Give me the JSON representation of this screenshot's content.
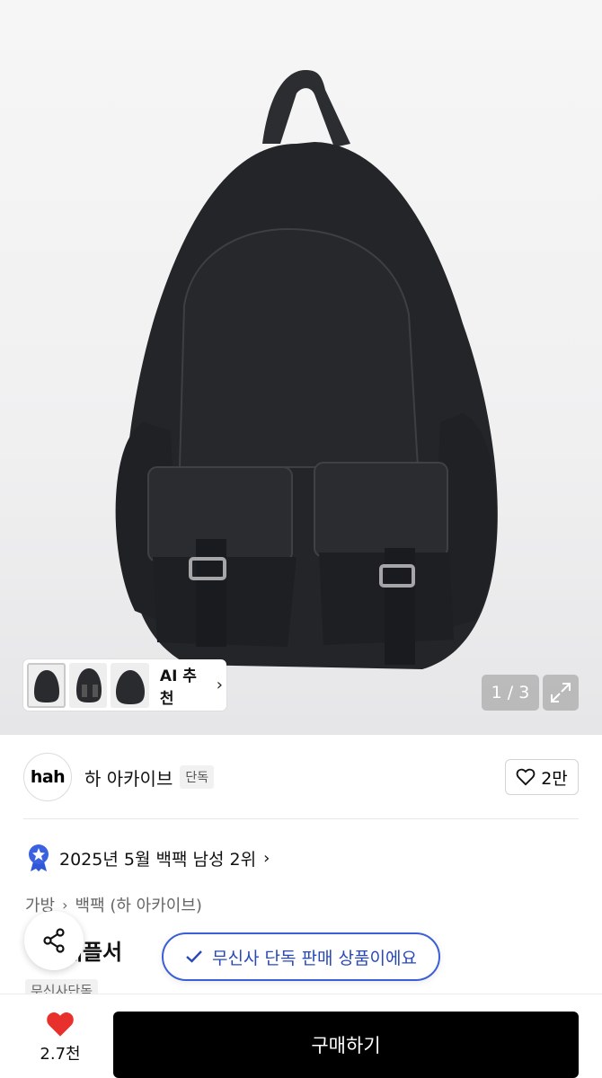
{
  "gallery": {
    "counter": "1 / 3",
    "ai_recommend_label": "AI 추천",
    "thumbnails": [
      "backpack-front",
      "backpack-pockets",
      "backpack-side"
    ]
  },
  "brand": {
    "logo_text": "hah",
    "name": "하 아카이브",
    "exclusive_tag": "단독",
    "like_count": "2만"
  },
  "ranking": {
    "text": "2025년 5월 백팩 남성 2위"
  },
  "category": {
    "level1": "가방",
    "level2": "백팩 (하 아카이브)"
  },
  "product": {
    "title_partial": "h 패플서",
    "badge_partial": "무신사단독"
  },
  "toast": {
    "text": "무신사 단독 판매 상품이에요"
  },
  "bottom": {
    "wishlist_count": "2.7천",
    "buy_label": "구매하기"
  },
  "colors": {
    "accent_blue": "#2748b8",
    "heart_red": "#e8312c",
    "buy_button": "#000000"
  }
}
